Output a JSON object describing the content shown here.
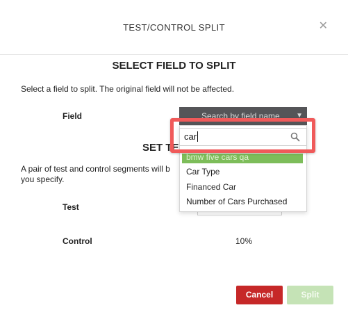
{
  "modal": {
    "title": "TEST/CONTROL SPLIT",
    "close_icon": "close-icon"
  },
  "select_section": {
    "heading": "SELECT FIELD TO SPLIT",
    "description": "Select a field to split. The original field will not be affected.",
    "field_label": "Field",
    "dropdown_placeholder": "Search by field name"
  },
  "set_section": {
    "heading_visible": "SET TE",
    "description_line1": "A pair of test and control segments will b",
    "description_line2": "you specify.",
    "test_label": "Test",
    "control_label": "Control",
    "control_value": "10%"
  },
  "field_dropdown": {
    "search_value": "car",
    "search_icon": "search-icon",
    "options": [
      {
        "label": "bmw five cars qa",
        "highlighted": true
      },
      {
        "label": "Car Type",
        "highlighted": false
      },
      {
        "label": "Financed Car",
        "highlighted": false
      },
      {
        "label": "Number of Cars Purchased",
        "highlighted": false
      }
    ]
  },
  "footer": {
    "cancel_label": "Cancel",
    "split_label": "Split"
  },
  "colors": {
    "cancel_bg": "#c62828",
    "split_bg_disabled": "#c5e3b6",
    "highlight_option": "#7dbd5a",
    "annotation_border": "#f05a5a",
    "dropdown_button_bg": "#555558"
  }
}
